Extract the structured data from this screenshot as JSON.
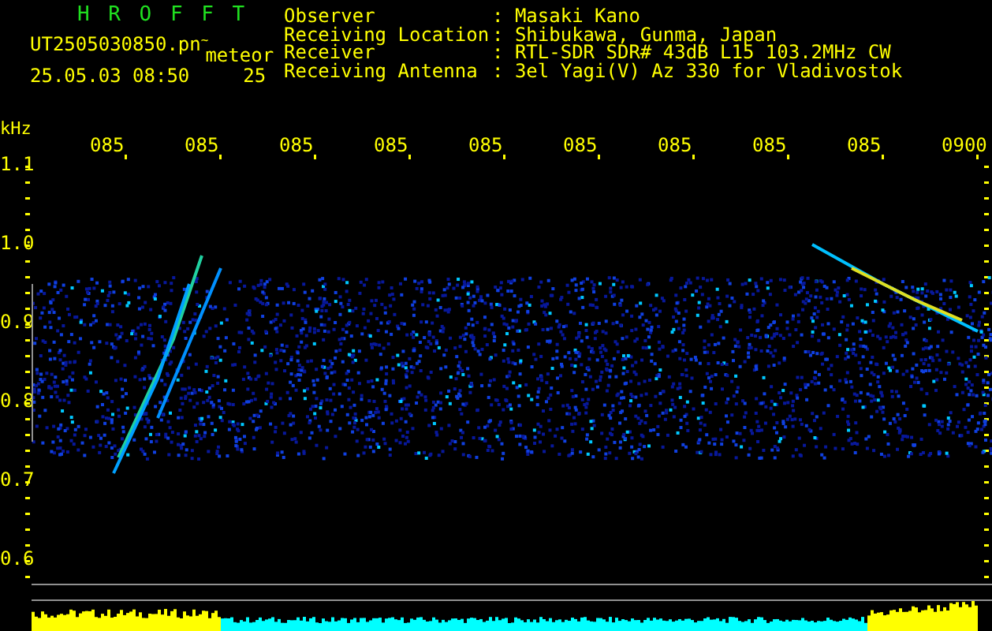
{
  "header": {
    "logo": "H R O F F T",
    "filename": "UT2505030850.pn",
    "filename_suffix": "~",
    "tag": "meteor",
    "datetime": "25.05.03 08:50",
    "count": "25"
  },
  "info": [
    {
      "label": "Observer",
      "value": ": Masaki Kano"
    },
    {
      "label": "Receiving Location",
      "value": ": Shibukawa, Gunma, Japan"
    },
    {
      "label": "Receiver",
      "value": ": RTL-SDR SDR# 43dB L15 103.2MHz CW"
    },
    {
      "label": "Receiving Antenna",
      "value": ": 3el Yagi(V) Az 330 for Vladivostok"
    }
  ],
  "plot": {
    "unit": "kHz",
    "time_labels": [
      "085",
      "085",
      "085",
      "085",
      "085",
      "085",
      "085",
      "085",
      "085",
      "0900"
    ],
    "freq_labels": [
      "1.1",
      "1.0",
      "0.9",
      "0.8",
      "0.7",
      "0.6"
    ]
  }
}
